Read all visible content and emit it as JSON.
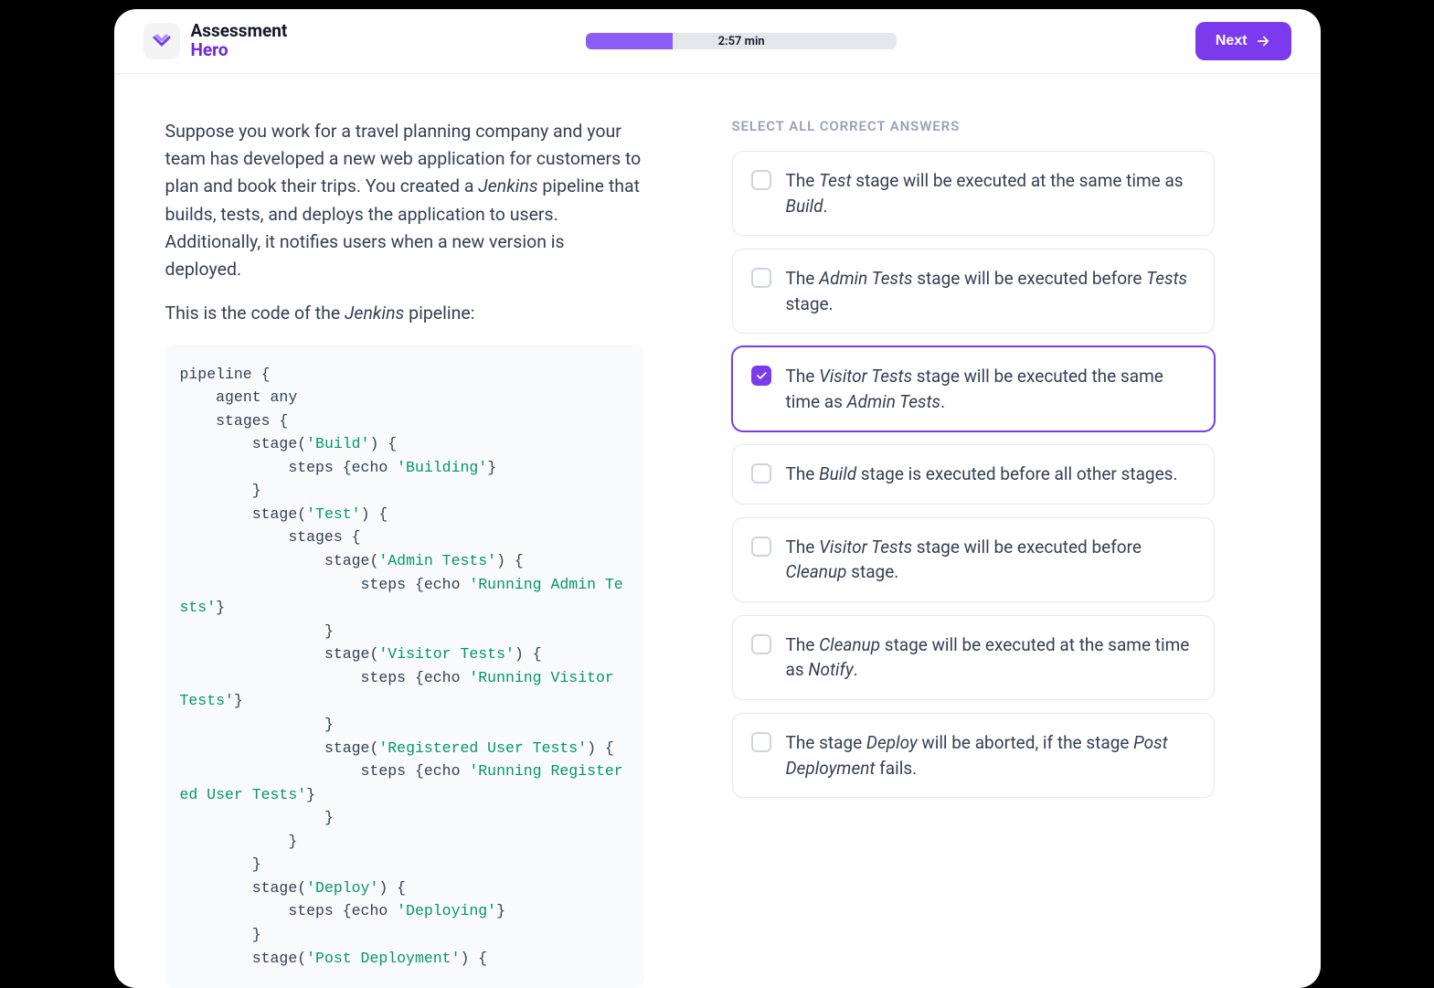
{
  "brand": {
    "line1": "Assessment",
    "line2": "Hero"
  },
  "progress": {
    "label": "2:57 min",
    "percent": 28
  },
  "next_label": "Next",
  "question": {
    "para1_pre": "Suppose you work for a travel planning company and your team has developed a new web application for customers to plan and book their trips. You created a ",
    "para1_em": "Jenkins",
    "para1_post": " pipeline that builds, tests, and deploys the application to users. Additionally, it notifies users when a new version is deployed.",
    "para2_pre": "This is the code of the ",
    "para2_em": "Jenkins",
    "para2_post": " pipeline:"
  },
  "code": {
    "l01": "pipeline {",
    "l02": "    agent any",
    "l03": "    stages {",
    "l04a": "        stage(",
    "l04s": "'Build'",
    "l04b": ") {",
    "l05a": "            steps {echo ",
    "l05s": "'Building'",
    "l05b": "}",
    "l06": "        }",
    "l07a": "        stage(",
    "l07s": "'Test'",
    "l07b": ") {",
    "l08": "            stages {",
    "l09a": "                stage(",
    "l09s": "'Admin Tests'",
    "l09b": ") {",
    "l10a": "                    steps {echo ",
    "l10s": "'Running Admin Tests'",
    "l10b": "}",
    "l11": "                }",
    "l12a": "                stage(",
    "l12s": "'Visitor Tests'",
    "l12b": ") {",
    "l13a": "                    steps {echo ",
    "l13s": "'Running Visitor Tests'",
    "l13b": "}",
    "l14": "                }",
    "l15a": "                stage(",
    "l15s": "'Registered User Tests'",
    "l15b": ") {",
    "l16a": "                    steps {echo ",
    "l16s": "'Running Registered User Tests'",
    "l16b": "}",
    "l17": "                }",
    "l18": "            }",
    "l19": "        }",
    "l20a": "        stage(",
    "l20s": "'Deploy'",
    "l20b": ") {",
    "l21a": "            steps {echo ",
    "l21s": "'Deploying'",
    "l21b": "}",
    "l22": "        }",
    "l23a": "        stage(",
    "l23s": "'Post Deployment'",
    "l23b": ") {"
  },
  "answers_title": "SELECT ALL CORRECT ANSWERS",
  "answers": [
    {
      "pre": "The ",
      "em1": "Test",
      "mid": " stage will be executed at the same time as ",
      "em2": "Build",
      "post": ".",
      "selected": false
    },
    {
      "pre": "The ",
      "em1": "Admin Tests",
      "mid": " stage will be executed before ",
      "em2": "Tests",
      "post": " stage.",
      "selected": false
    },
    {
      "pre": "The ",
      "em1": "Visitor Tests",
      "mid": " stage will be executed the same time as ",
      "em2": "Admin Tests",
      "post": ".",
      "selected": true
    },
    {
      "pre": "The ",
      "em1": "Build",
      "mid": " stage is executed before all other stages.",
      "em2": "",
      "post": "",
      "selected": false
    },
    {
      "pre": "The ",
      "em1": "Visitor Tests",
      "mid": " stage will be executed before ",
      "em2": "Cleanup",
      "post": " stage.",
      "selected": false
    },
    {
      "pre": "The ",
      "em1": "Cleanup",
      "mid": " stage will be executed at the same time as ",
      "em2": "Notify",
      "post": ".",
      "selected": false
    },
    {
      "pre": "The stage ",
      "em1": "Deploy",
      "mid": " will be aborted, if the stage ",
      "em2": "Post Deployment",
      "post": " fails.",
      "selected": false
    }
  ]
}
